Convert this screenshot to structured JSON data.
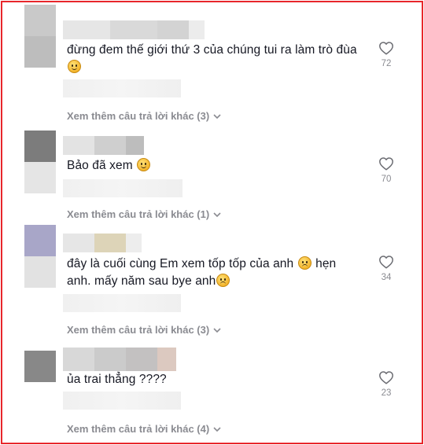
{
  "comments": [
    {
      "text": "đừng đem thế giới thứ 3 của chúng tui ra làm trò đùa",
      "emoji": "grinning-sweat-emoji",
      "likes": "72",
      "replies": "Xem thêm câu trả lời khác (3)",
      "avatar_color": "#c9c9c9"
    },
    {
      "text": "Bảo đã xem",
      "emoji": "smiling-emoji",
      "likes": "70",
      "replies": "Xem thêm câu trả lời khác (1)",
      "avatar_color": "#7c7c7c"
    },
    {
      "text_line1": "đây là cuối cùng Em xem tốp tốp của anh",
      "text_mid": "hẹn",
      "text_line2": "anh. mấy năm sau bye anh",
      "emoji": "frowning-emoji",
      "likes": "34",
      "replies": "Xem thêm câu trả lời khác (3)",
      "avatar_color": "#a8a6c8"
    },
    {
      "text": "ủa trai thẳng ????",
      "likes": "23",
      "replies": "Xem thêm câu trả lời khác (4)",
      "avatar_color": "#888888"
    }
  ],
  "colors": {
    "border": "#e8262b",
    "text": "#161823",
    "muted": "#8a8b91"
  }
}
